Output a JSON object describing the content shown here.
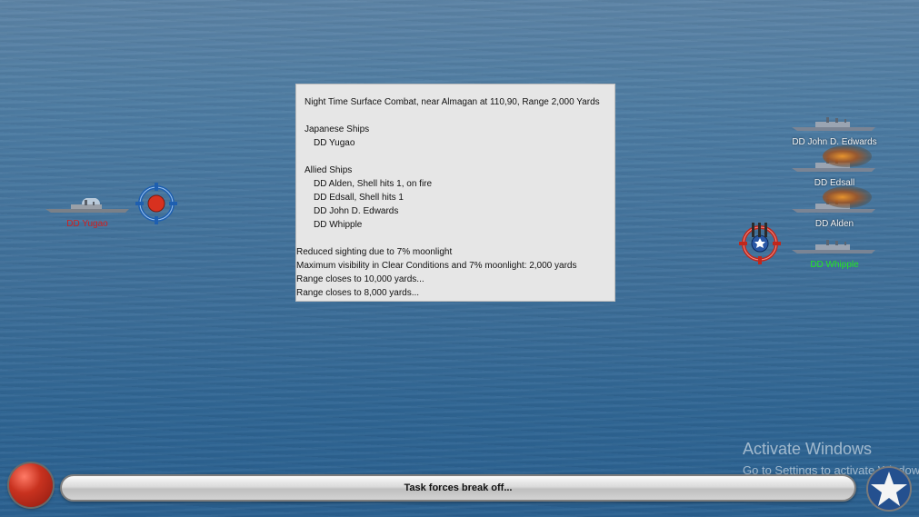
{
  "combat_report": {
    "lines": [
      "Night Time Surface Combat, near Almagan at 110,90, Range 2,000 Yards",
      "Japanese Ships",
      "DD Yugao",
      "Allied Ships",
      "DD Alden, Shell hits 1,  on fire",
      "DD Edsall, Shell hits 1",
      "DD John D. Edwards",
      "DD Whipple",
      "Reduced sighting due to 7% moonlight",
      "Maximum visibility in Clear Conditions and 7% moonlight: 2,000 yards",
      "Range closes to 10,000 yards...",
      "Range closes to 8,000 yards..."
    ]
  },
  "japanese_ships": [
    {
      "label": "DD Yugao",
      "label_color": "#d21f1f"
    }
  ],
  "allied_ships": [
    {
      "label": "DD John D. Edwards",
      "on_fire": false,
      "label_color": "#f2f2f2"
    },
    {
      "label": "DD Edsall",
      "on_fire": true,
      "label_color": "#f2f2f2"
    },
    {
      "label": "DD Alden",
      "on_fire": true,
      "label_color": "#f2f2f2"
    },
    {
      "label": "DD Whipple",
      "on_fire": false,
      "label_color": "#22e622"
    }
  ],
  "status_bar": {
    "text": "Task forces break off..."
  },
  "icons": {
    "japanese_target": "target-icon",
    "allied_target": "gun-target-icon",
    "stop": "stop-button",
    "allied_emblem": "allied-star-icon"
  },
  "watermark": {
    "line1": "Activate Windows",
    "line2": "Go to Settings to activate Windows."
  }
}
